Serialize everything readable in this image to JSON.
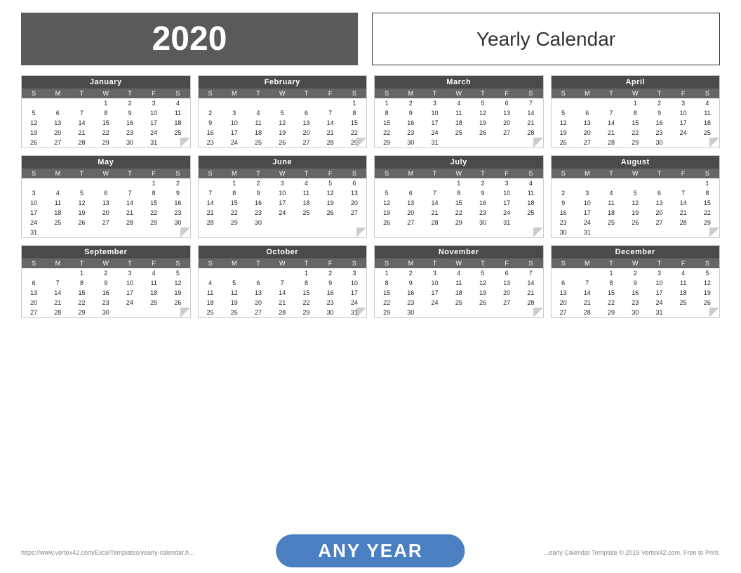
{
  "header": {
    "year": "2020",
    "title": "Yearly Calendar"
  },
  "footer": {
    "left": "https://www.vertex42.com/ExcelTemplates/yearly-calendar.h...",
    "center": "ANY YEAR",
    "right": "...early Calendar Template © 2019 Vertex42.com. Free to Print."
  },
  "days_of_week": [
    "S",
    "M",
    "T",
    "W",
    "T",
    "F",
    "S"
  ],
  "months": [
    {
      "name": "January",
      "start": 3,
      "days": 31,
      "weeks": [
        [
          "",
          "",
          "",
          "1",
          "2",
          "3",
          "4"
        ],
        [
          "5",
          "6",
          "7",
          "8",
          "9",
          "10",
          "11"
        ],
        [
          "12",
          "13",
          "14",
          "15",
          "16",
          "17",
          "18"
        ],
        [
          "19",
          "20",
          "21",
          "22",
          "23",
          "24",
          "25"
        ],
        [
          "26",
          "27",
          "28",
          "29",
          "30",
          "31",
          ""
        ]
      ]
    },
    {
      "name": "February",
      "start": 6,
      "days": 29,
      "weeks": [
        [
          "",
          "",
          "",
          "",
          "",
          "",
          "1"
        ],
        [
          "2",
          "3",
          "4",
          "5",
          "6",
          "7",
          "8"
        ],
        [
          "9",
          "10",
          "11",
          "12",
          "13",
          "14",
          "15"
        ],
        [
          "16",
          "17",
          "18",
          "19",
          "20",
          "21",
          "22"
        ],
        [
          "23",
          "24",
          "25",
          "26",
          "27",
          "28",
          "29"
        ]
      ]
    },
    {
      "name": "March",
      "start": 0,
      "days": 31,
      "weeks": [
        [
          "1",
          "2",
          "3",
          "4",
          "5",
          "6",
          "7"
        ],
        [
          "8",
          "9",
          "10",
          "11",
          "12",
          "13",
          "14"
        ],
        [
          "15",
          "16",
          "17",
          "18",
          "19",
          "20",
          "21"
        ],
        [
          "22",
          "23",
          "24",
          "25",
          "26",
          "27",
          "28"
        ],
        [
          "29",
          "30",
          "31",
          "",
          "",
          "",
          ""
        ]
      ]
    },
    {
      "name": "April",
      "start": 3,
      "days": 30,
      "weeks": [
        [
          "",
          "",
          "",
          "1",
          "2",
          "3",
          "4"
        ],
        [
          "5",
          "6",
          "7",
          "8",
          "9",
          "10",
          "11"
        ],
        [
          "12",
          "13",
          "14",
          "15",
          "16",
          "17",
          "18"
        ],
        [
          "19",
          "20",
          "21",
          "22",
          "23",
          "24",
          "25"
        ],
        [
          "26",
          "27",
          "28",
          "29",
          "30",
          "",
          ""
        ]
      ]
    },
    {
      "name": "May",
      "start": 5,
      "days": 31,
      "weeks": [
        [
          "",
          "",
          "",
          "",
          "",
          "1",
          "2"
        ],
        [
          "3",
          "4",
          "5",
          "6",
          "7",
          "8",
          "9"
        ],
        [
          "10",
          "11",
          "12",
          "13",
          "14",
          "15",
          "16"
        ],
        [
          "17",
          "18",
          "19",
          "20",
          "21",
          "22",
          "23"
        ],
        [
          "24",
          "25",
          "26",
          "27",
          "28",
          "29",
          "30"
        ],
        [
          "31",
          "",
          "",
          "",
          "",
          "",
          ""
        ]
      ]
    },
    {
      "name": "June",
      "start": 1,
      "days": 30,
      "weeks": [
        [
          "",
          "1",
          "2",
          "3",
          "4",
          "5",
          "6"
        ],
        [
          "7",
          "8",
          "9",
          "10",
          "11",
          "12",
          "13"
        ],
        [
          "14",
          "15",
          "16",
          "17",
          "18",
          "19",
          "20"
        ],
        [
          "21",
          "22",
          "23",
          "24",
          "25",
          "26",
          "27"
        ],
        [
          "28",
          "29",
          "30",
          "",
          "",
          "",
          ""
        ]
      ]
    },
    {
      "name": "July",
      "start": 3,
      "days": 31,
      "weeks": [
        [
          "",
          "",
          "",
          "1",
          "2",
          "3",
          "4"
        ],
        [
          "5",
          "6",
          "7",
          "8",
          "9",
          "10",
          "11"
        ],
        [
          "12",
          "13",
          "14",
          "15",
          "16",
          "17",
          "18"
        ],
        [
          "19",
          "20",
          "21",
          "22",
          "23",
          "24",
          "25"
        ],
        [
          "26",
          "27",
          "28",
          "29",
          "30",
          "31",
          ""
        ]
      ]
    },
    {
      "name": "August",
      "start": 6,
      "days": 31,
      "weeks": [
        [
          "",
          "",
          "",
          "",
          "",
          "",
          "1"
        ],
        [
          "2",
          "3",
          "4",
          "5",
          "6",
          "7",
          "8"
        ],
        [
          "9",
          "10",
          "11",
          "12",
          "13",
          "14",
          "15"
        ],
        [
          "16",
          "17",
          "18",
          "19",
          "20",
          "21",
          "22"
        ],
        [
          "23",
          "24",
          "25",
          "26",
          "27",
          "28",
          "29"
        ],
        [
          "30",
          "31",
          "",
          "",
          "",
          "",
          ""
        ]
      ]
    },
    {
      "name": "September",
      "start": 2,
      "days": 30,
      "weeks": [
        [
          "",
          "",
          "1",
          "2",
          "3",
          "4",
          "5"
        ],
        [
          "6",
          "7",
          "8",
          "9",
          "10",
          "11",
          "12"
        ],
        [
          "13",
          "14",
          "15",
          "16",
          "17",
          "18",
          "19"
        ],
        [
          "20",
          "21",
          "22",
          "23",
          "24",
          "25",
          "26"
        ],
        [
          "27",
          "28",
          "29",
          "30",
          "",
          "",
          ""
        ]
      ]
    },
    {
      "name": "October",
      "start": 4,
      "days": 31,
      "weeks": [
        [
          "",
          "",
          "",
          "",
          "1",
          "2",
          "3"
        ],
        [
          "4",
          "5",
          "6",
          "7",
          "8",
          "9",
          "10"
        ],
        [
          "11",
          "12",
          "13",
          "14",
          "15",
          "16",
          "17"
        ],
        [
          "18",
          "19",
          "20",
          "21",
          "22",
          "23",
          "24"
        ],
        [
          "25",
          "26",
          "27",
          "28",
          "29",
          "30",
          "31"
        ]
      ]
    },
    {
      "name": "November",
      "start": 0,
      "days": 30,
      "weeks": [
        [
          "1",
          "2",
          "3",
          "4",
          "5",
          "6",
          "7"
        ],
        [
          "8",
          "9",
          "10",
          "11",
          "12",
          "13",
          "14"
        ],
        [
          "15",
          "16",
          "17",
          "18",
          "19",
          "20",
          "21"
        ],
        [
          "22",
          "23",
          "24",
          "25",
          "26",
          "27",
          "28"
        ],
        [
          "29",
          "30",
          "",
          "",
          "",
          "",
          ""
        ]
      ]
    },
    {
      "name": "December",
      "start": 2,
      "days": 31,
      "weeks": [
        [
          "",
          "",
          "1",
          "2",
          "3",
          "4",
          "5"
        ],
        [
          "6",
          "7",
          "8",
          "9",
          "10",
          "11",
          "12"
        ],
        [
          "13",
          "14",
          "15",
          "16",
          "17",
          "18",
          "19"
        ],
        [
          "20",
          "21",
          "22",
          "23",
          "24",
          "25",
          "26"
        ],
        [
          "27",
          "28",
          "29",
          "30",
          "31",
          "",
          ""
        ]
      ]
    }
  ]
}
